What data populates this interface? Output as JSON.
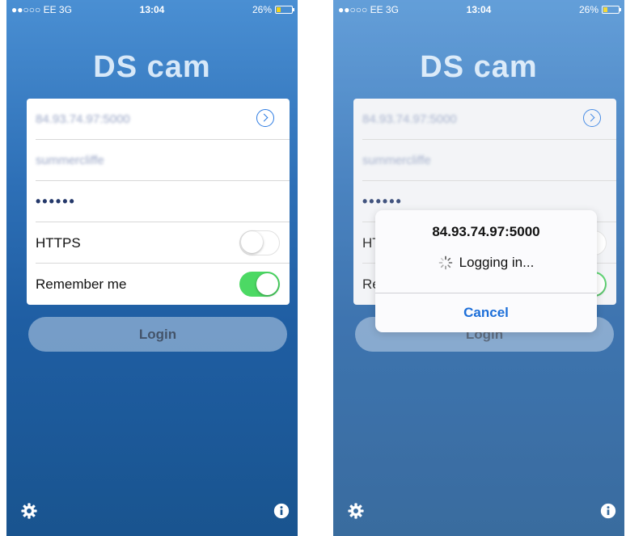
{
  "status_bar": {
    "carrier": "●●○○○ EE  3G",
    "time": "13:04",
    "battery": "26%",
    "battery_fill_percent": 26
  },
  "app": {
    "title": "DS cam"
  },
  "form": {
    "address_value": "84.93.74.97:5000",
    "username_value": "summercliffe",
    "password_masked": "••••••",
    "https_label": "HTTPS",
    "https_enabled": false,
    "remember_label": "Remember me",
    "remember_enabled": true
  },
  "login_button": {
    "label": "Login"
  },
  "toolbar": {
    "settings_icon": "gear-icon",
    "info_icon": "info-icon"
  },
  "dialog": {
    "title": "84.93.74.97:5000",
    "message": "Logging in...",
    "cancel_label": "Cancel"
  },
  "colors": {
    "background_top": "#4a8fd3",
    "background_bottom": "#19548f",
    "toggle_on": "#4cd964",
    "link_blue": "#1d6fd9"
  }
}
